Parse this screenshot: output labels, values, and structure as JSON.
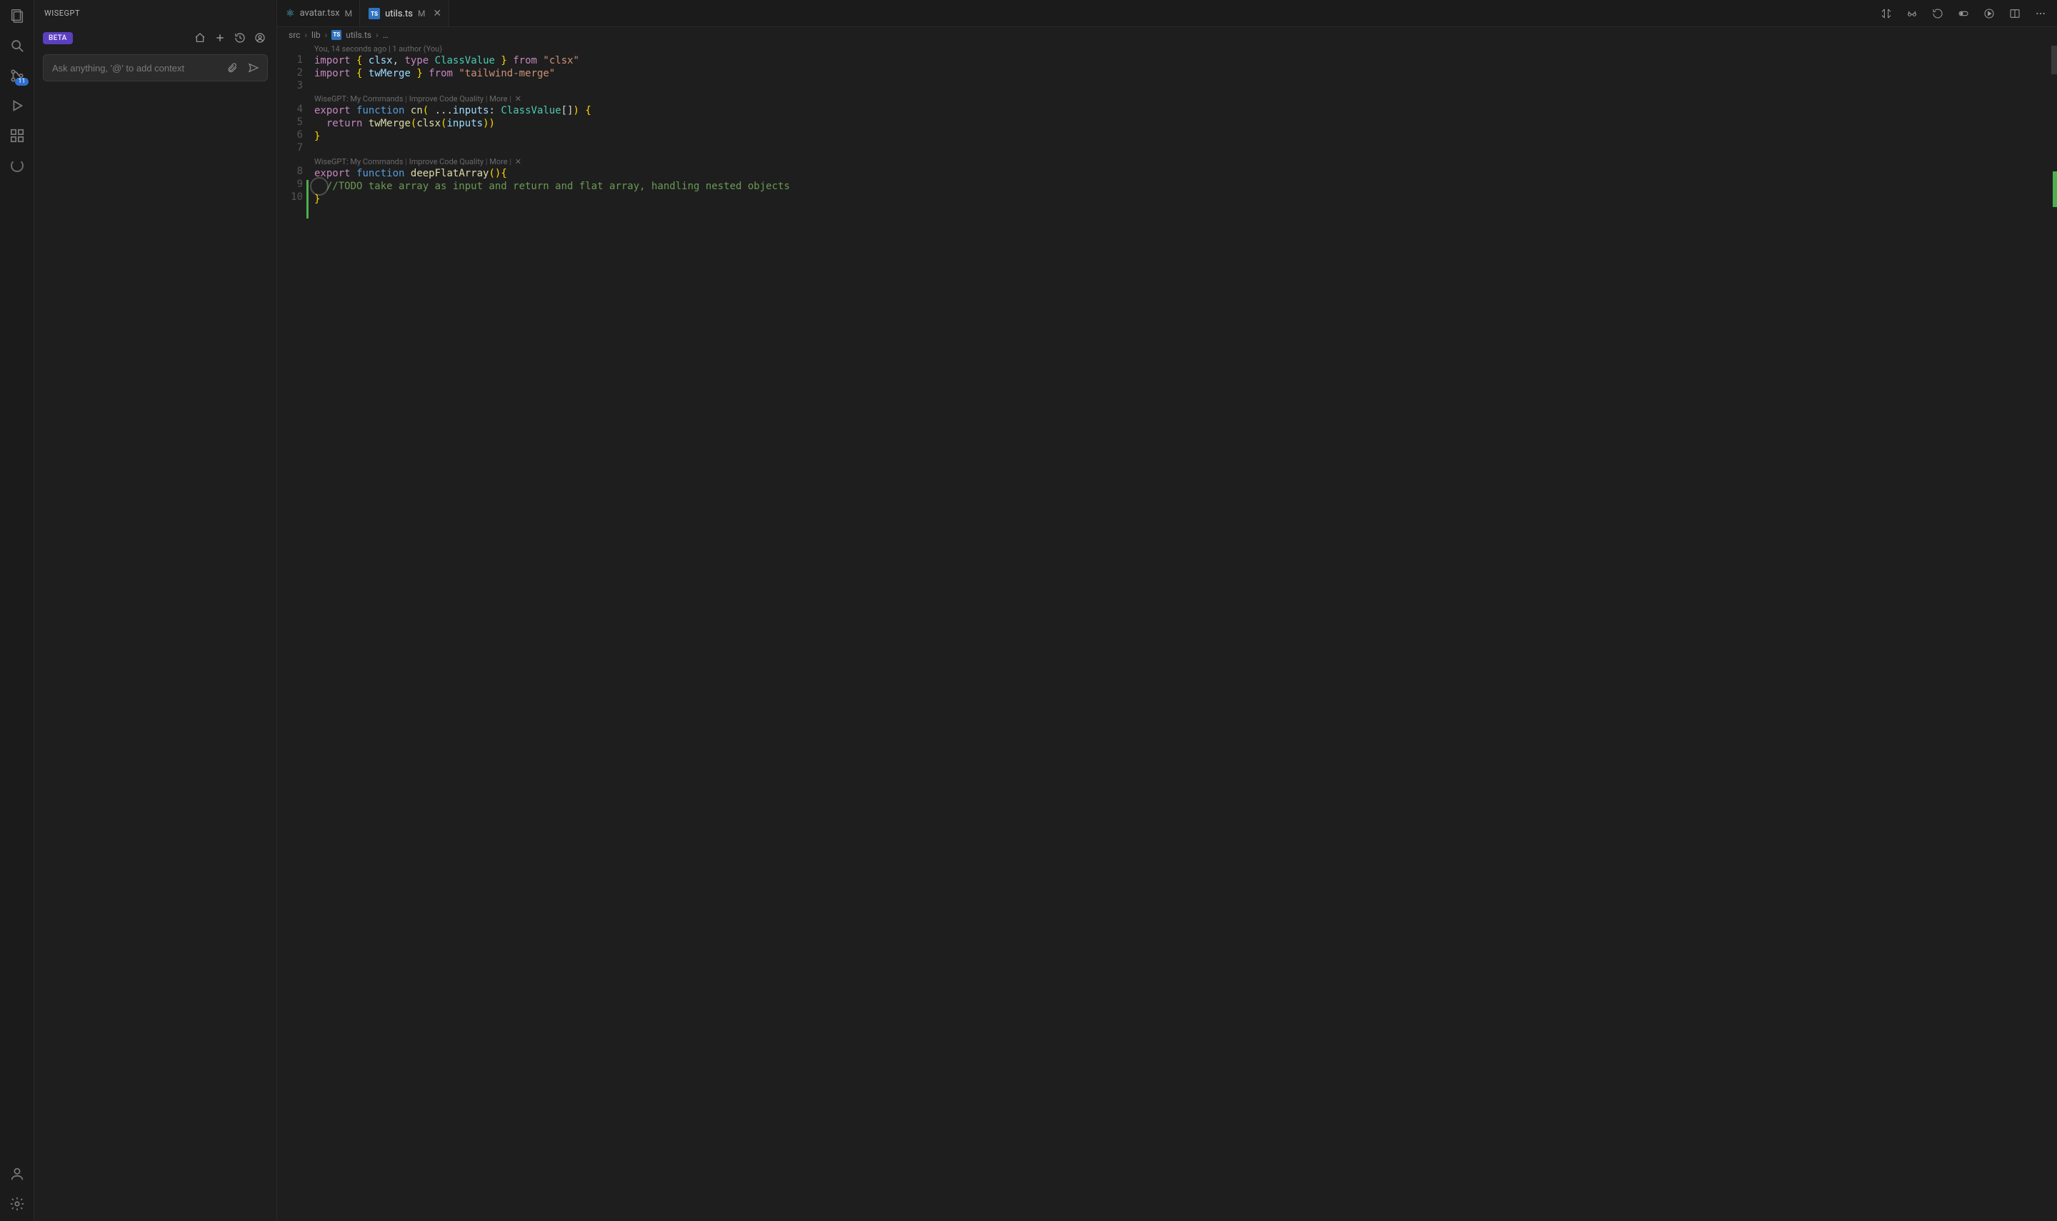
{
  "sidebar": {
    "title": "WISEGPT",
    "beta": "BETA",
    "scm_badge": "11",
    "ask_placeholder": "Ask anything, '@' to add context"
  },
  "tabs": [
    {
      "name": "avatar.tsx",
      "kind": "react",
      "modified": "M",
      "active": false
    },
    {
      "name": "utils.ts",
      "kind": "ts",
      "modified": "M",
      "active": true,
      "closeable": true
    }
  ],
  "breadcrumb": {
    "seg0": "src",
    "seg1": "lib",
    "seg2": "utils.ts",
    "tail": "…"
  },
  "blame": "You, 14 seconds ago | 1 author (You)",
  "codelens": {
    "prefix": "WiseGPT:",
    "a": "My Commands",
    "b": "Improve Code Quality",
    "c": "More",
    "close": "✕"
  },
  "code": {
    "l1": {
      "import": "import",
      "ob": "{",
      "clsx": "clsx",
      "comma": ",",
      "type": "type",
      "ClassValue": "ClassValue",
      "cb": "}",
      "from": "from",
      "str": "\"clsx\""
    },
    "l2": {
      "import": "import",
      "ob": "{",
      "twMerge": "twMerge",
      "cb": "}",
      "from": "from",
      "str": "\"tailwind-merge\""
    },
    "l4": {
      "export": "export",
      "function": "function",
      "cn": "cn",
      "op": "(",
      "spread": "...",
      "inputs": "inputs",
      "colon": ":",
      "ty": "ClassValue",
      "arr": "[]",
      "cp": ")",
      "ob": "{"
    },
    "l5": {
      "return": "return",
      "twMerge": "twMerge",
      "op1": "(",
      "clsx": "clsx",
      "op2": "(",
      "inputs": "inputs",
      "cp2": ")",
      "cp1": ")"
    },
    "l6": {
      "cb": "}"
    },
    "l8": {
      "export": "export",
      "function": "function",
      "name": "deepFlatArray",
      "parens": "()",
      "ob": "{"
    },
    "l9": {
      "cmt": "//TODO take array as input and return and flat array, handling nested objects"
    },
    "l10": {
      "cb": "}"
    }
  },
  "line_numbers": [
    "1",
    "2",
    "3",
    "4",
    "5",
    "6",
    "7",
    "8",
    "9",
    "10"
  ]
}
